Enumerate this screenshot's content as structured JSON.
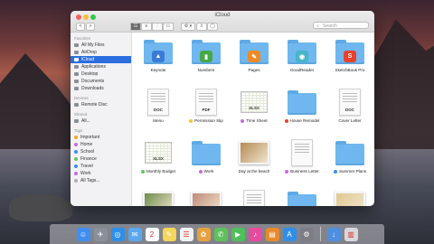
{
  "window": {
    "title": "iCloud",
    "search_placeholder": "Search"
  },
  "toolbar": {
    "back_glyph": "<",
    "forward_glyph": ">",
    "view_icon": "☷",
    "list_icon": "≡",
    "column_icon": "⋮",
    "cover_icon": "▭",
    "action_icon": "⚙ ▾",
    "share_icon": "⇪",
    "tag_icon": "◯",
    "search_icon": "⌕"
  },
  "sidebar": {
    "favorites_header": "Favorites",
    "favorites": [
      {
        "label": "All My Files",
        "selected": false
      },
      {
        "label": "AirDrop",
        "selected": false
      },
      {
        "label": "iCloud",
        "selected": true
      },
      {
        "label": "Applications",
        "selected": false
      },
      {
        "label": "Desktop",
        "selected": false
      },
      {
        "label": "Documents",
        "selected": false
      },
      {
        "label": "Downloads",
        "selected": false
      }
    ],
    "devices_header": "Devices",
    "devices": [
      {
        "label": "Remote Disc"
      }
    ],
    "shared_header": "Shared",
    "shared": [
      {
        "label": "All..."
      }
    ],
    "tags_header": "Tags",
    "tags": [
      {
        "label": "Important",
        "color": "#f5a623"
      },
      {
        "label": "Home",
        "color": "#c86be0"
      },
      {
        "label": "School",
        "color": "#3b8ef0"
      },
      {
        "label": "Finance",
        "color": "#5cc85c"
      },
      {
        "label": "Travel",
        "color": "#3b8ef0"
      },
      {
        "label": "Work",
        "color": "#c86be0"
      },
      {
        "label": "All Tags...",
        "color": "#b0b0b0"
      }
    ]
  },
  "files": [
    {
      "label": "Keynote",
      "kind": "folder-app",
      "icon": "keynote-icon",
      "app_color": "#3a7bd5",
      "glyph": "▲"
    },
    {
      "label": "Numbers",
      "kind": "folder-app",
      "icon": "numbers-icon",
      "app_color": "#46a946",
      "glyph": "▮"
    },
    {
      "label": "Pages",
      "kind": "folder-app",
      "icon": "pages-icon",
      "app_color": "#f08a24",
      "glyph": "✎"
    },
    {
      "label": "GoodReader",
      "kind": "folder-app",
      "icon": "goodreader-icon",
      "app_color": "#48b4c8",
      "glyph": "◉"
    },
    {
      "label": "SketchBook Pro",
      "kind": "folder-app",
      "icon": "sketchbook-icon",
      "app_color": "#e8402b",
      "glyph": "S"
    },
    {
      "label": "Menu",
      "kind": "doc",
      "tag": "DOC"
    },
    {
      "label": "Permission Slip",
      "kind": "doc",
      "tag": "PDF",
      "tag_color": "#f5c623"
    },
    {
      "label": "Time Sheet",
      "kind": "sheet",
      "tag": "XLSX",
      "tag_color": "#c86be0"
    },
    {
      "label": "House Remodel",
      "kind": "folder",
      "tag_color": "#e8402b"
    },
    {
      "label": "Cover Letter",
      "kind": "doc",
      "tag": "DOC"
    },
    {
      "label": "Monthly Budget",
      "kind": "sheet",
      "tag": "XLSX",
      "tag_color": "#5cc85c"
    },
    {
      "label": "Work",
      "kind": "folder",
      "tag_color": "#c86be0"
    },
    {
      "label": "Day at the beach",
      "kind": "photo",
      "photo_color": "#b48a52"
    },
    {
      "label": "Business Letter",
      "kind": "doc",
      "tag": "",
      "tag_color": "#c86be0"
    },
    {
      "label": "Summer Plans",
      "kind": "folder",
      "tag_color": "#3b8ef0"
    },
    {
      "label": "",
      "kind": "photo",
      "photo_color": "#6d8a4a"
    },
    {
      "label": "",
      "kind": "photo",
      "photo_color": "#c08a78"
    },
    {
      "label": "",
      "kind": "doc",
      "tag": ""
    },
    {
      "label": "",
      "kind": "folder"
    },
    {
      "label": "",
      "kind": "photo",
      "photo_color": "#e0c890"
    }
  ],
  "dock": [
    {
      "name": "finder-icon",
      "color": "#3f8ef2",
      "glyph": "☺"
    },
    {
      "name": "launchpad-icon",
      "color": "#8a8f99",
      "glyph": "✈"
    },
    {
      "name": "safari-icon",
      "color": "#2f8fe8",
      "glyph": "◎"
    },
    {
      "name": "mail-icon",
      "color": "#5aa8ee",
      "glyph": "✉"
    },
    {
      "name": "calendar-icon",
      "color": "#ffffff",
      "glyph": "2"
    },
    {
      "name": "notes-icon",
      "color": "#f3d65a",
      "glyph": "✎"
    },
    {
      "name": "reminders-icon",
      "color": "#f2f2f2",
      "glyph": "☰"
    },
    {
      "name": "photos-icon",
      "color": "#e8a040",
      "glyph": "✿"
    },
    {
      "name": "messages-icon",
      "color": "#5ec05a",
      "glyph": "✆"
    },
    {
      "name": "facetime-icon",
      "color": "#4fbf5a",
      "glyph": "▶"
    },
    {
      "name": "itunes-icon",
      "color": "#e84aa0",
      "glyph": "♪"
    },
    {
      "name": "ibooks-icon",
      "color": "#e88a2a",
      "glyph": "▤"
    },
    {
      "name": "appstore-icon",
      "color": "#2f8fe8",
      "glyph": "A"
    },
    {
      "name": "preferences-icon",
      "color": "#7d7d85",
      "glyph": "⚙"
    },
    {
      "name": "downloads-stack-icon",
      "color": "#4d8fe0",
      "glyph": "↓"
    },
    {
      "name": "trash-icon",
      "color": "#d8d8dc",
      "glyph": "▥"
    }
  ]
}
